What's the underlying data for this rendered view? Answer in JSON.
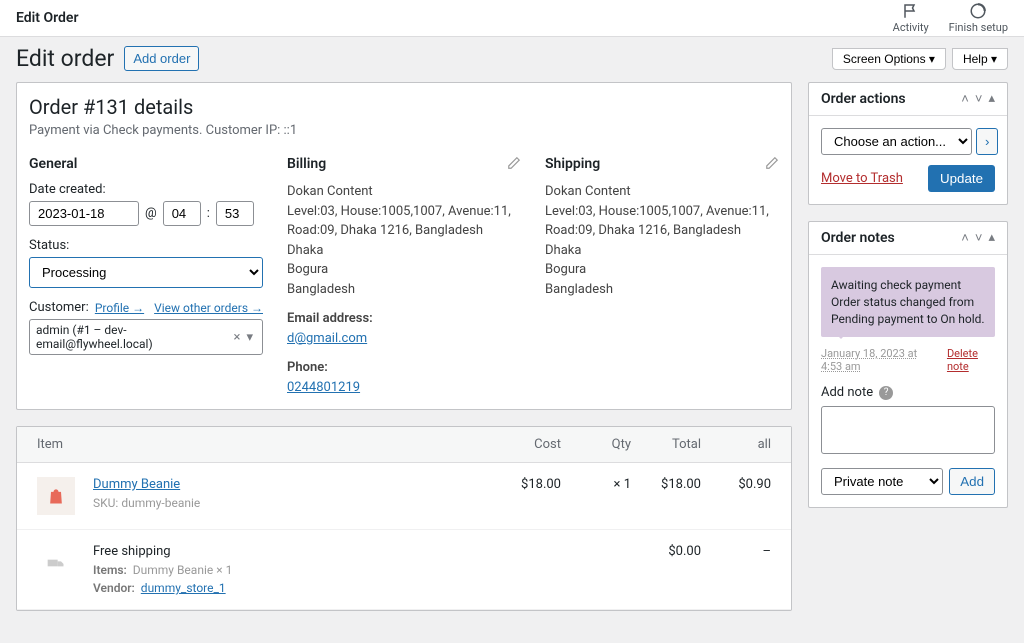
{
  "topBar": {
    "title": "Edit Order",
    "activity": "Activity",
    "finishSetup": "Finish setup"
  },
  "header": {
    "pageTitle": "Edit order",
    "addNew": "Add order",
    "screenOptions": "Screen Options ▾",
    "help": "Help ▾"
  },
  "orderDetails": {
    "title": "Order #131 details",
    "paymentInfo": "Payment via Check payments. Customer IP: ::1",
    "general": {
      "heading": "General",
      "dateCreatedLabel": "Date created:",
      "date": "2023-01-18",
      "atSymbol": "@",
      "hour": "04",
      "colon": ":",
      "minute": "53",
      "statusLabel": "Status:",
      "status": "Processing",
      "customerLabel": "Customer:",
      "profileLink": "Profile →",
      "viewOthers": "View other orders →",
      "customerValue": "admin (#1 – dev-email@flywheel.local)"
    },
    "billing": {
      "heading": "Billing",
      "name": "Dokan Content",
      "line1": "Level:03, House:1005,1007, Avenue:11, Road:09, Dhaka 1216, Bangladesh",
      "city": "Dhaka",
      "state": "Bogura",
      "country": "Bangladesh",
      "emailLabel": "Email address:",
      "email": "d@gmail.com",
      "phoneLabel": "Phone:",
      "phone": "0244801219"
    },
    "shipping": {
      "heading": "Shipping",
      "name": "Dokan Content",
      "line1": "Level:03, House:1005,1007, Avenue:11, Road:09, Dhaka 1216, Bangladesh",
      "city": "Dhaka",
      "state": "Bogura",
      "country": "Bangladesh"
    }
  },
  "items": {
    "headers": {
      "item": "Item",
      "cost": "Cost",
      "qty": "Qty",
      "total": "Total",
      "all": "all"
    },
    "rows": [
      {
        "name": "Dummy Beanie",
        "skuLabel": "SKU:",
        "sku": "dummy-beanie",
        "cost": "$18.00",
        "qty": "× 1",
        "total": "$18.00",
        "all": "$0.90"
      }
    ],
    "shipping": {
      "name": "Free shipping",
      "itemsLabel": "Items:",
      "itemsVal": "Dummy Beanie × 1",
      "vendorLabel": "Vendor:",
      "vendor": "dummy_store_1",
      "total": "$0.00",
      "dash": "–"
    }
  },
  "orderActions": {
    "heading": "Order actions",
    "choose": "Choose an action...",
    "moveToTrash": "Move to Trash",
    "update": "Update"
  },
  "orderNotes": {
    "heading": "Order notes",
    "noteContent": "Awaiting check payment Order status changed from Pending payment to On hold.",
    "timestamp": "January 18, 2023 at 4:53 am",
    "deleteNote": "Delete note",
    "addNoteLabel": "Add note",
    "noteType": "Private note",
    "addBtn": "Add"
  }
}
